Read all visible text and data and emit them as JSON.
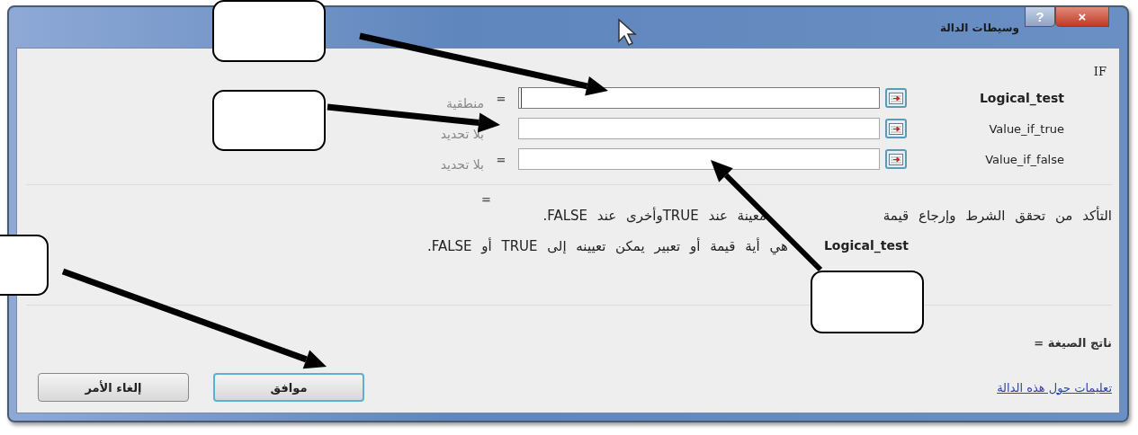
{
  "window": {
    "title": "وسيطات الدالة",
    "help_button": "?",
    "close_button": "×"
  },
  "function_name": "IF",
  "arguments": [
    {
      "label": "Logical_test",
      "bold": true,
      "focused": true,
      "equals": "=",
      "result": "منطقية"
    },
    {
      "label": "Value_if_true",
      "bold": false,
      "focused": false,
      "result": "بلا تحديد"
    },
    {
      "label": "Value_if_false",
      "bold": false,
      "focused": false,
      "equals": "=",
      "result": "بلا تحديد"
    }
  ],
  "overall_result": "=",
  "description": [
    "التأكد من تحقق الشرط وإرجاع قيمة",
    "معينة عند TRUEوأخرى عند FALSE."
  ],
  "argument_help": {
    "name": "Logical_test",
    "text": "هي أية قيمة أو تعبير يمكن تعيينه إلى TRUE أو FALSE."
  },
  "formula_result": "ناتج الصيغة =",
  "help_link": "تعليمات حول هذه الدالة",
  "buttons": [
    {
      "label": "موافق",
      "default": true
    },
    {
      "label": "إلغاء الأمر",
      "default": false
    }
  ]
}
